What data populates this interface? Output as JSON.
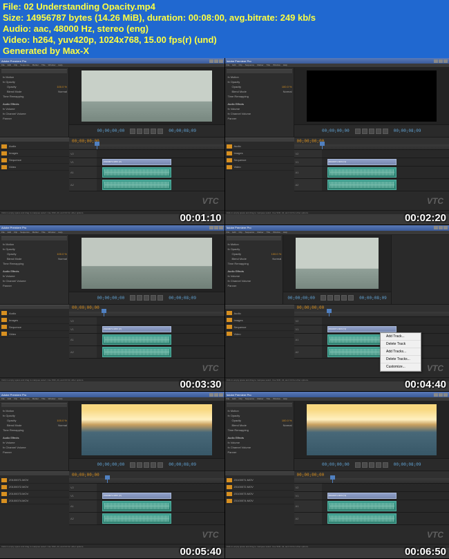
{
  "header": {
    "file": "File: 02 Understanding Opacity.mp4",
    "size": "Size: 14956787 bytes (14.26 MiB), duration: 00:08:00, avg.bitrate: 249 kb/s",
    "audio": "Audio: aac, 48000 Hz, stereo (eng)",
    "video": "Video: h264, yuv420p, 1024x768, 15.00 fps(r) (und)",
    "gen": "Generated by Max-X"
  },
  "app_title": "Adobe Premiere Pro",
  "menus": [
    "File",
    "Edit",
    "Clip",
    "Sequence",
    "Marker",
    "Title",
    "Window",
    "Help"
  ],
  "effects": {
    "motion": "fx Motion",
    "opacity": "fx Opacity",
    "opacity_label": "Opacity",
    "opacity_val": "100.0 %",
    "blend": "Blend Mode",
    "blend_val": "Normal",
    "time": "Time Remapping",
    "audio": "Audio Effects",
    "volume": "fx Volume",
    "chvol": "fx Channel Volume",
    "panner": "Panner"
  },
  "transport_tc_left": "00;00;00;00",
  "transport_tc_right": "00;00;08;09",
  "proj_items": [
    "Audio",
    "Images",
    "Sequence",
    "Video"
  ],
  "proj_files": [
    "Z0100071.MOV",
    "Z0100072.MOV",
    "Z0100073.MOV",
    "Z0100074.MOV"
  ],
  "timeline_tc": "00;00;00;00",
  "tracks": {
    "v3": "V3",
    "v2": "V2",
    "v1": "V1",
    "a1": "A1",
    "a2": "A2"
  },
  "clip_name": "Z0100071.MOV [V]",
  "context": [
    "Add Track...",
    "Delete Track",
    "Add Tracks...",
    "Delete Tracks...",
    "Customize..."
  ],
  "status_msg": "Click in empty space and drag to marquee select. Use Shift, Alt, and Ctrl for other options.",
  "watermark": "VTC",
  "thumbs": [
    {
      "ts": "00:01:10",
      "img": "sky",
      "play": 40
    },
    {
      "ts": "00:02:20",
      "img": "black",
      "play": 40
    },
    {
      "ts": "00:03:30",
      "img": "sea",
      "play": 50
    },
    {
      "ts": "00:04:40",
      "img": "sky",
      "play": 50,
      "menu": true
    },
    {
      "ts": "00:05:40",
      "img": "sunset",
      "play": 55
    },
    {
      "ts": "00:06:50",
      "img": "sunset",
      "play": 55
    }
  ]
}
